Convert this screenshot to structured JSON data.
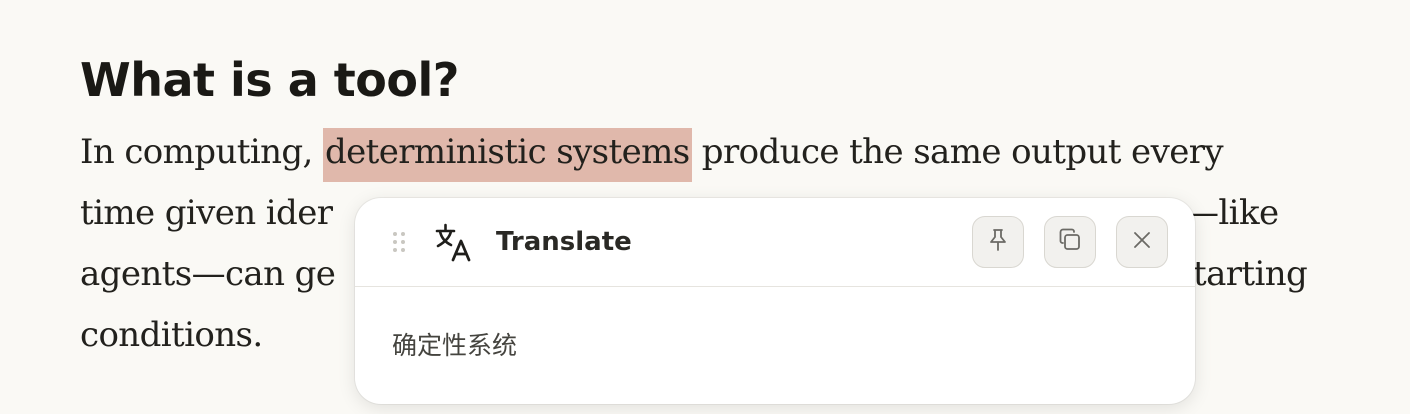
{
  "article": {
    "heading": "What is a tool?",
    "line1_before": "In computing, ",
    "highlighted": "deterministic systems",
    "line1_after": " produce the same output every",
    "line2": "time given ider",
    "line2_end": "—like",
    "line3": "agents—can ge",
    "line3_end": "tarting",
    "line4": "conditions."
  },
  "popup": {
    "title": "Translate",
    "translation": "确定性系统",
    "icons": {
      "drag": "drag-handle-icon",
      "translate": "translate-icon",
      "pin": "pin-icon",
      "copy": "copy-icon",
      "close": "close-icon"
    }
  },
  "colors": {
    "background": "#faf9f5",
    "highlight": "#e0b8ab",
    "popup_bg": "#ffffff"
  }
}
